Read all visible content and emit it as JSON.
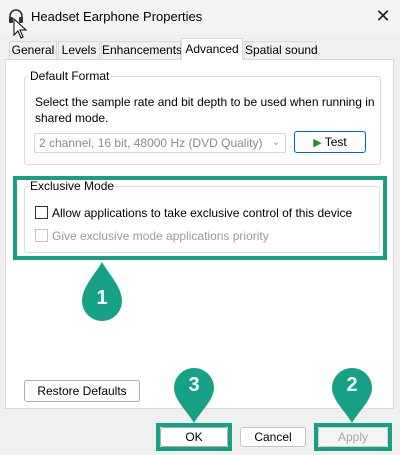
{
  "window": {
    "title": "Headset Earphone Properties",
    "close_glyph": "✕"
  },
  "tabs": [
    {
      "label": "General"
    },
    {
      "label": "Levels"
    },
    {
      "label": "Enhancements"
    },
    {
      "label": "Advanced",
      "active": true
    },
    {
      "label": "Spatial sound"
    }
  ],
  "default_format": {
    "legend": "Default Format",
    "description": "Select the sample rate and bit depth to be used when running in shared mode.",
    "selected_format": "2 channel, 16 bit, 48000 Hz (DVD Quality)",
    "test_label": "Test"
  },
  "exclusive_mode": {
    "legend": "Exclusive Mode",
    "allow_label": "Allow applications to take exclusive control of this device",
    "allow_checked": false,
    "priority_label": "Give exclusive mode applications priority",
    "priority_checked": false,
    "priority_disabled": true
  },
  "buttons": {
    "restore_defaults": "Restore Defaults",
    "ok": "OK",
    "cancel": "Cancel",
    "apply": "Apply",
    "apply_disabled": true
  },
  "annotations": [
    {
      "number": "1"
    },
    {
      "number": "2"
    },
    {
      "number": "3"
    }
  ],
  "colors": {
    "highlight": "#16a085",
    "test_play": "#2a8a2a",
    "focus_border": "#0067c0"
  }
}
